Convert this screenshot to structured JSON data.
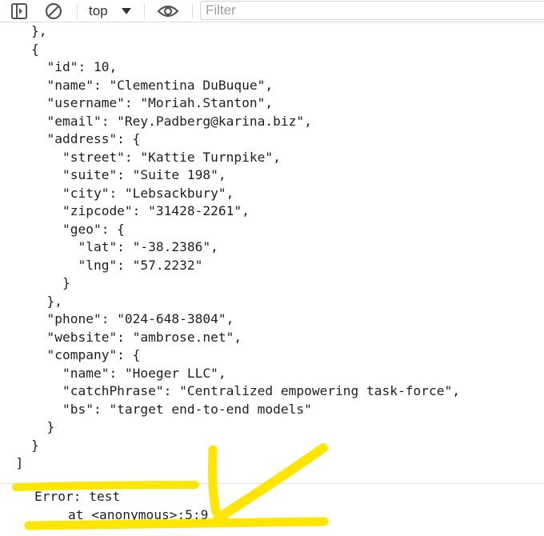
{
  "toolbar": {
    "context_label": "top",
    "filter_placeholder": "Filter",
    "icons": [
      "sidebar-toggle-icon",
      "clear-console-icon",
      "dropdown-arrow-icon",
      "eye-icon"
    ]
  },
  "console_lines": [
    "    },",
    "    {",
    "      \"id\": 10,",
    "      \"name\": \"Clementina DuBuque\",",
    "      \"username\": \"Moriah.Stanton\",",
    "      \"email\": \"Rey.Padberg@karina.biz\",",
    "      \"address\": {",
    "        \"street\": \"Kattie Turnpike\",",
    "        \"suite\": \"Suite 198\",",
    "        \"city\": \"Lebsackbury\",",
    "        \"zipcode\": \"31428-2261\",",
    "        \"geo\": {",
    "          \"lat\": \"-38.2386\",",
    "          \"lng\": \"57.2232\"",
    "        }",
    "      },",
    "      \"phone\": \"024-648-3804\",",
    "      \"website\": \"ambrose.net\",",
    "      \"company\": {",
    "        \"name\": \"Hoeger LLC\",",
    "        \"catchPhrase\": \"Centralized empowering task-force\",",
    "        \"bs\": \"target end-to-end models\"",
    "      }",
    "    }",
    "  ]"
  ],
  "error": {
    "message": "Error: test",
    "stack": "at <anonymous>:5:9"
  },
  "colors": {
    "highlight": "#ffe600",
    "text": "#1f1f1f",
    "toolbar_icon": "#555555"
  }
}
